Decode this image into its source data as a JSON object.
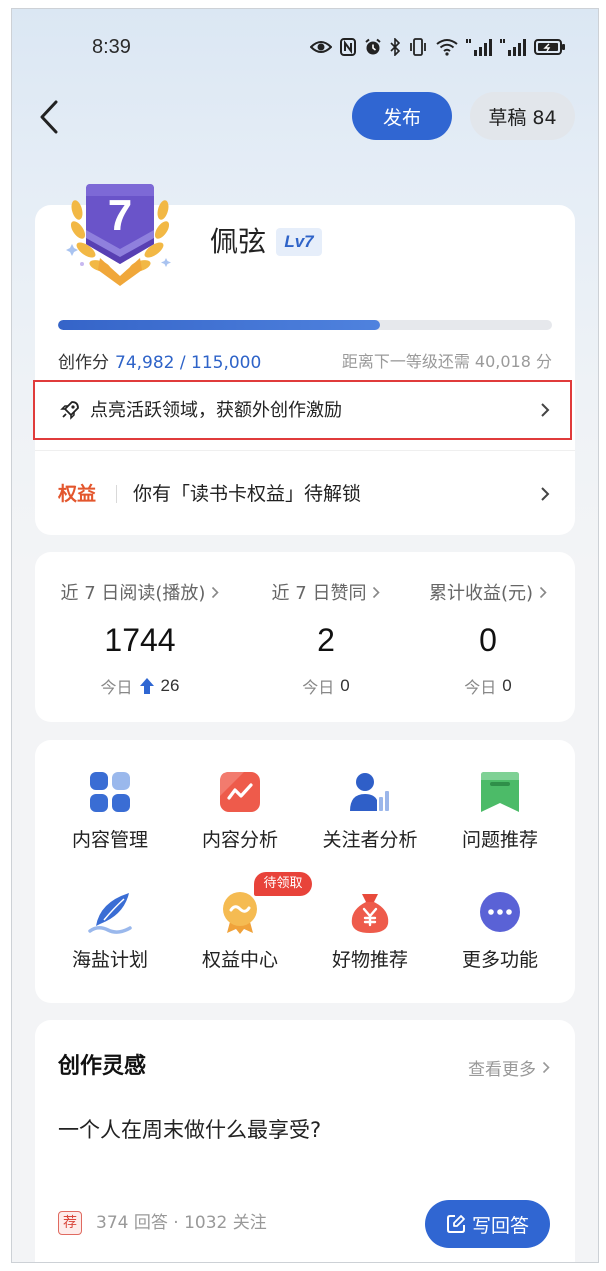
{
  "status_bar": {
    "time": "8:39",
    "icons": [
      "eye-icon",
      "nfc-icon",
      "alarm-icon",
      "bluetooth-icon",
      "vibrate-icon",
      "wifi-icon",
      "cellular-signal-icon",
      "cellular-signal-icon",
      "battery-charging-icon"
    ]
  },
  "header": {
    "back_icon": "back-arrow-icon",
    "publish_label": "发布",
    "drafts_label": "草稿 84"
  },
  "profile": {
    "level_number": "7",
    "name": "佩弦",
    "level_tag": "Lv7",
    "progress": 0.652,
    "score_label": "创作分",
    "score_value": "74,982 / 115,000",
    "next_level_text": "距离下一等级还需 40,018 分"
  },
  "promo": {
    "icon": "rocket-icon",
    "text": "点亮活跃领域，获额外创作激励"
  },
  "benefits": {
    "tag": "权益",
    "text": "你有「读书卡权益」待解锁"
  },
  "stats": {
    "items": [
      {
        "label": "近 7 日阅读(播放)",
        "value": "1744",
        "today_label": "今日",
        "today_value": "26",
        "trend": "up"
      },
      {
        "label": "近 7 日赞同",
        "value": "2",
        "today_label": "今日",
        "today_value": "0"
      },
      {
        "label": "累计收益(元)",
        "value": "0",
        "today_label": "今日",
        "today_value": "0"
      }
    ]
  },
  "tools": {
    "items": [
      {
        "label": "内容管理",
        "icon": "content-grid-icon"
      },
      {
        "label": "内容分析",
        "icon": "analytics-chart-icon"
      },
      {
        "label": "关注者分析",
        "icon": "follower-analysis-icon"
      },
      {
        "label": "问题推荐",
        "icon": "question-bookmark-icon"
      },
      {
        "label": "海盐计划",
        "icon": "feather-icon"
      },
      {
        "label": "权益中心",
        "icon": "medal-icon",
        "badge": "待领取"
      },
      {
        "label": "好物推荐",
        "icon": "money-bag-icon"
      },
      {
        "label": "更多功能",
        "icon": "more-icon"
      }
    ]
  },
  "inspiration": {
    "title": "创作灵感",
    "more_label": "查看更多",
    "question": "一个人在周末做什么最享受?",
    "tag": "荐",
    "meta": "374 回答 · 1032 关注",
    "write_button": "写回答"
  },
  "colors": {
    "brand_blue": "#3066d2",
    "benefit_red": "#e3562d",
    "badge_red": "#e8433a",
    "highlight_box_red": "#e03b3b",
    "level_purple": "#6a54c9"
  }
}
